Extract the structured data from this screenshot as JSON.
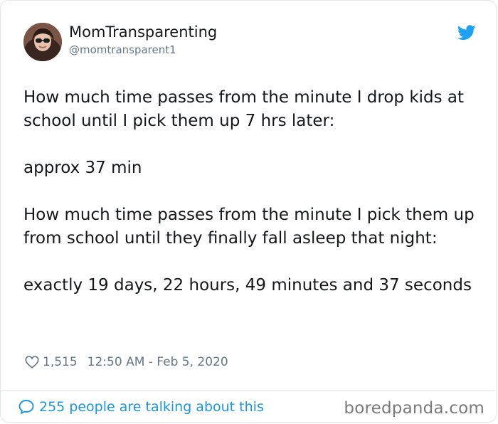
{
  "author": {
    "name": "MomTransparenting",
    "handle": "@momtransparent1",
    "avatar_icon": "profile-photo"
  },
  "tweet": {
    "paragraphs": [
      "How much time passes from the minute I drop kids at school until I pick them up 7 hrs later:",
      "approx 37 min",
      "How much time passes from the minute I pick them up from school until they finally fall asleep that night:",
      "exactly 19 days, 22 hours, 49 minutes and 37 seconds"
    ]
  },
  "meta": {
    "likes": "1,515",
    "timestamp": "12:50 AM - Feb 5, 2020"
  },
  "footer": {
    "talking_label": "255 people are talking about this"
  },
  "watermark": "boredpanda.com",
  "colors": {
    "twitter_blue": "#1da1f2",
    "link_blue": "#1b95e0",
    "muted_gray": "#657786",
    "text": "#14171a"
  }
}
